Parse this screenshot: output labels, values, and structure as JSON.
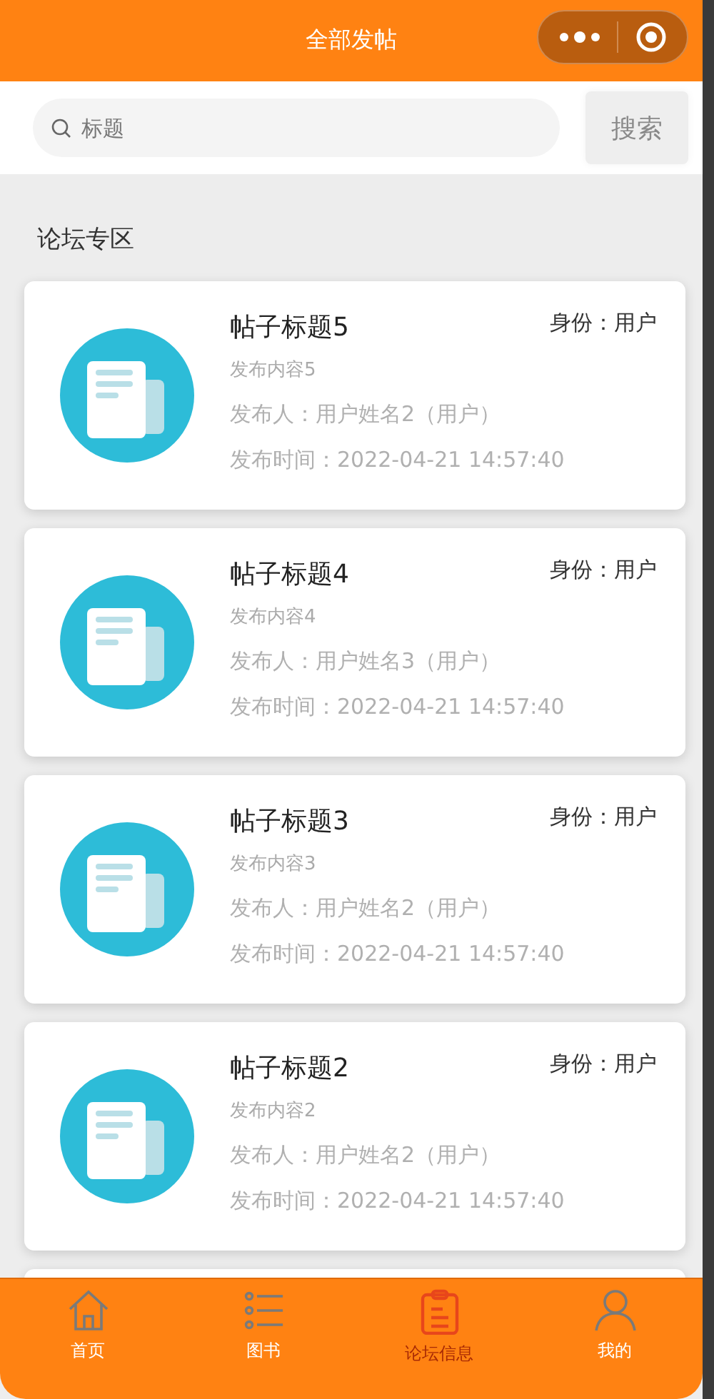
{
  "header": {
    "title": "全部发帖"
  },
  "search": {
    "placeholder": "标题",
    "button": "搜索"
  },
  "section_title": "论坛专区",
  "posts": [
    {
      "title": "帖子标题5",
      "role": "身份：用户",
      "content": "发布内容5",
      "author": "发布人：用户姓名2（用户）",
      "time": "发布时间：2022-04-21 14:57:40"
    },
    {
      "title": "帖子标题4",
      "role": "身份：用户",
      "content": "发布内容4",
      "author": "发布人：用户姓名3（用户）",
      "time": "发布时间：2022-04-21 14:57:40"
    },
    {
      "title": "帖子标题3",
      "role": "身份：用户",
      "content": "发布内容3",
      "author": "发布人：用户姓名2（用户）",
      "time": "发布时间：2022-04-21 14:57:40"
    },
    {
      "title": "帖子标题2",
      "role": "身份：用户",
      "content": "发布内容2",
      "author": "发布人：用户姓名2（用户）",
      "time": "发布时间：2022-04-21 14:57:40"
    }
  ],
  "tabs": [
    {
      "kind": "home",
      "label": "首页",
      "selected": false
    },
    {
      "kind": "list",
      "label": "图书",
      "selected": false
    },
    {
      "kind": "clipboard",
      "label": "论坛信息",
      "selected": true
    },
    {
      "kind": "user",
      "label": "我的",
      "selected": false
    }
  ]
}
